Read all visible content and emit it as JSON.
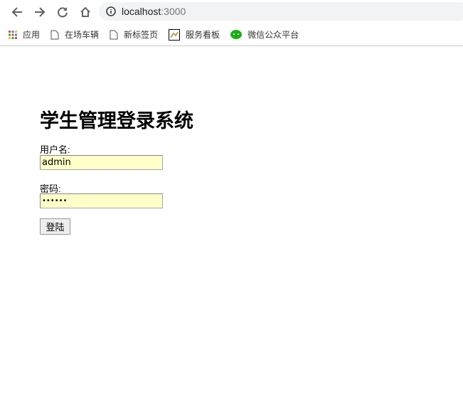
{
  "browser": {
    "url_host": "localhost",
    "url_port": ":3000"
  },
  "bookmarks": [
    {
      "label": "应用"
    },
    {
      "label": "在场车辆"
    },
    {
      "label": "新标签页"
    },
    {
      "label": "服务看板"
    },
    {
      "label": "微信公众平台"
    }
  ],
  "page": {
    "title": "学生管理登录系统",
    "username_label": "用户名:",
    "username_value": "admin",
    "password_label": "密码:",
    "password_value": "••••••",
    "login_label": "登陆"
  }
}
